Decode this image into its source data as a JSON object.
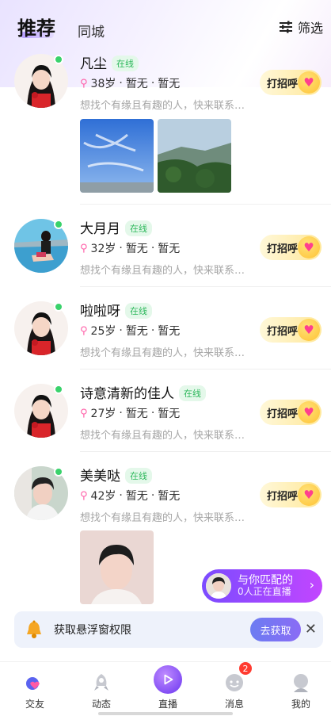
{
  "header": {
    "tab_recommend": "推荐",
    "tab_city": "同城",
    "filter_label": "筛选"
  },
  "cards": [
    {
      "name": "凡尘",
      "status": "在线",
      "age": "38岁",
      "f1": "暂无",
      "f2": "暂无",
      "bio": "想找个有缘且有趣的人，快来联系…",
      "greet": "打招呼",
      "photos": 2
    },
    {
      "name": "大月月",
      "status": "在线",
      "age": "32岁",
      "f1": "暂无",
      "f2": "暂无",
      "bio": "想找个有缘且有趣的人，快来联系…",
      "greet": "打招呼",
      "photos": 0
    },
    {
      "name": "啦啦呀",
      "status": "在线",
      "age": "25岁",
      "f1": "暂无",
      "f2": "暂无",
      "bio": "想找个有缘且有趣的人，快来联系…",
      "greet": "打招呼",
      "photos": 0
    },
    {
      "name": "诗意清新的佳人",
      "status": "在线",
      "age": "27岁",
      "f1": "暂无",
      "f2": "暂无",
      "bio": "想找个有缘且有趣的人，快来联系…",
      "greet": "打招呼",
      "photos": 0
    },
    {
      "name": "美美哒",
      "status": "在线",
      "age": "42岁",
      "f1": "暂无",
      "f2": "暂无",
      "bio": "想找个有缘且有趣的人，快来联系…",
      "greet": "打招呼",
      "photos": 1
    }
  ],
  "separator": "·",
  "match": {
    "title": "与你匹配的",
    "subtitle": "0人正在直播",
    "arrow": "›"
  },
  "float_bar": {
    "text": "获取悬浮窗权限",
    "button": "去获取",
    "close": "✕"
  },
  "nav": {
    "items": [
      "交友",
      "动态",
      "直播",
      "消息",
      "我的"
    ],
    "message_badge": "2"
  },
  "colors": {
    "online": "#39d26b",
    "accent": "#7b4bff",
    "greet_bg": "#ffe89a",
    "badge": "#ff3b30"
  }
}
